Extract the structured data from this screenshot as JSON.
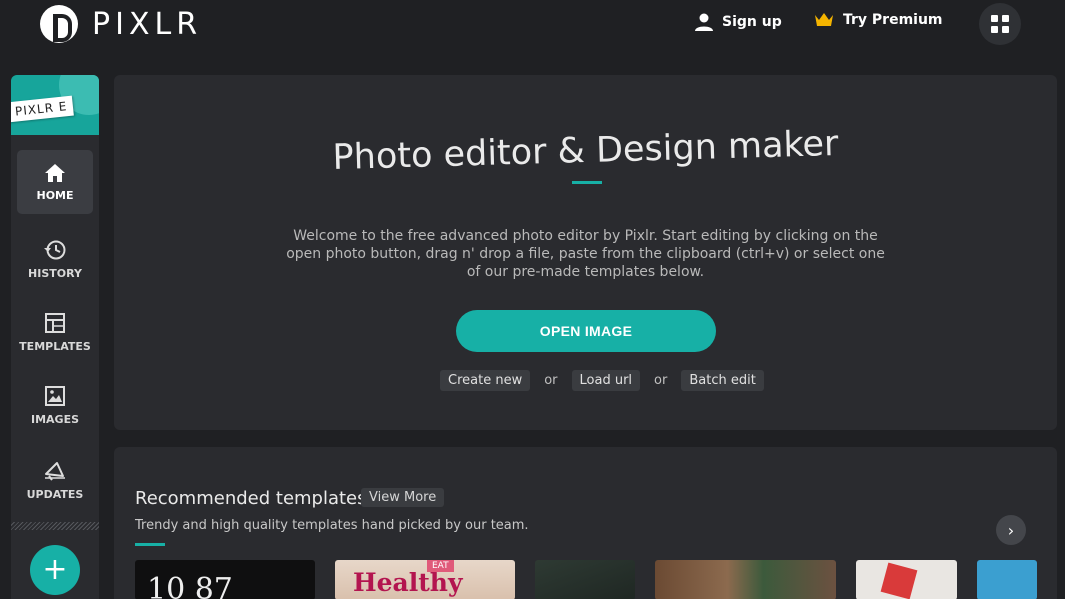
{
  "header": {
    "logo_text": "PIXLR",
    "signup_label": "Sign up",
    "premium_label": "Try Premium"
  },
  "sidebar": {
    "brand_tag": "PIXLR E",
    "items": [
      {
        "label": "HOME",
        "icon": "home-icon"
      },
      {
        "label": "HISTORY",
        "icon": "history-icon"
      },
      {
        "label": "TEMPLATES",
        "icon": "templates-icon"
      },
      {
        "label": "IMAGES",
        "icon": "images-icon"
      },
      {
        "label": "UPDATES",
        "icon": "updates-icon"
      }
    ],
    "fab_label": "+"
  },
  "hero": {
    "title": "Photo editor & Design maker",
    "description": "Welcome to the free advanced photo editor by Pixlr. Start editing by clicking on the open photo button, drag n' drop a file, paste from the clipboard (ctrl+v) or select one of our pre-made templates below.",
    "open_button": "OPEN IMAGE",
    "links": [
      "Create new",
      "Load url",
      "Batch edit"
    ],
    "or_text": "or"
  },
  "recommended": {
    "title": "Recommended templates",
    "view_more": "View More",
    "subtitle": "Trendy and high quality templates hand picked by our team.",
    "thumb1_text": "10 87",
    "thumb2_text": "Healthy Food",
    "thumb2_tag": "EAT"
  },
  "colors": {
    "accent": "#17b0a6",
    "background": "#1f2023",
    "panel": "#2a2b2f"
  }
}
